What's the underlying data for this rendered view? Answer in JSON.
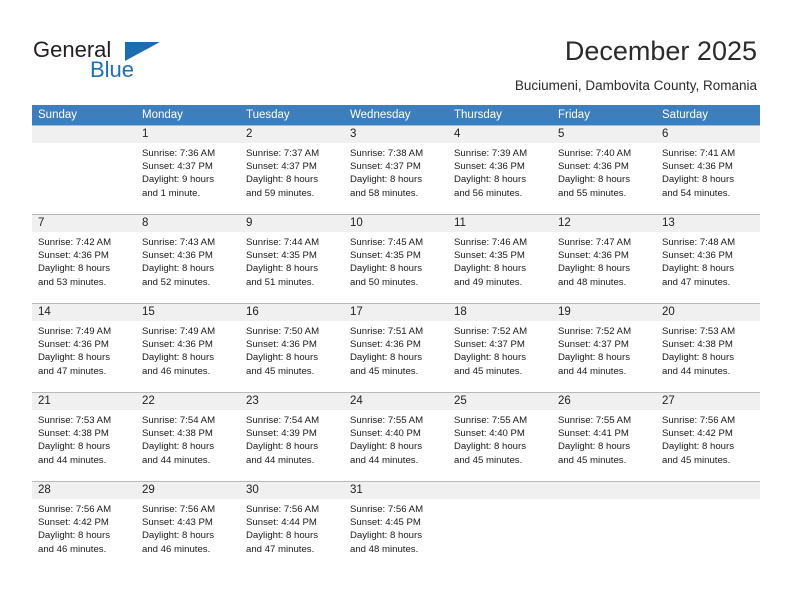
{
  "brand": {
    "name_part1": "General",
    "name_part2": "Blue",
    "triangle_color": "#1e6cb0",
    "blue_color": "#1f6fb5"
  },
  "header": {
    "title": "December 2025",
    "location": "Buciumeni, Dambovita County, Romania"
  },
  "theme": {
    "header_row_bg": "#3d7ebd",
    "header_row_text": "#ffffff",
    "daynum_band_bg": "#f0f0f0",
    "grid_line": "#b9b9b9",
    "body_text": "#1a1a1a"
  },
  "calendar": {
    "weekday_headers": [
      "Sunday",
      "Monday",
      "Tuesday",
      "Wednesday",
      "Thursday",
      "Friday",
      "Saturday"
    ],
    "weeks": [
      [
        {
          "day": "",
          "detail": ""
        },
        {
          "day": "1",
          "detail": "Sunrise: 7:36 AM\nSunset: 4:37 PM\nDaylight: 9 hours\nand 1 minute."
        },
        {
          "day": "2",
          "detail": "Sunrise: 7:37 AM\nSunset: 4:37 PM\nDaylight: 8 hours\nand 59 minutes."
        },
        {
          "day": "3",
          "detail": "Sunrise: 7:38 AM\nSunset: 4:37 PM\nDaylight: 8 hours\nand 58 minutes."
        },
        {
          "day": "4",
          "detail": "Sunrise: 7:39 AM\nSunset: 4:36 PM\nDaylight: 8 hours\nand 56 minutes."
        },
        {
          "day": "5",
          "detail": "Sunrise: 7:40 AM\nSunset: 4:36 PM\nDaylight: 8 hours\nand 55 minutes."
        },
        {
          "day": "6",
          "detail": "Sunrise: 7:41 AM\nSunset: 4:36 PM\nDaylight: 8 hours\nand 54 minutes."
        }
      ],
      [
        {
          "day": "7",
          "detail": "Sunrise: 7:42 AM\nSunset: 4:36 PM\nDaylight: 8 hours\nand 53 minutes."
        },
        {
          "day": "8",
          "detail": "Sunrise: 7:43 AM\nSunset: 4:36 PM\nDaylight: 8 hours\nand 52 minutes."
        },
        {
          "day": "9",
          "detail": "Sunrise: 7:44 AM\nSunset: 4:35 PM\nDaylight: 8 hours\nand 51 minutes."
        },
        {
          "day": "10",
          "detail": "Sunrise: 7:45 AM\nSunset: 4:35 PM\nDaylight: 8 hours\nand 50 minutes."
        },
        {
          "day": "11",
          "detail": "Sunrise: 7:46 AM\nSunset: 4:35 PM\nDaylight: 8 hours\nand 49 minutes."
        },
        {
          "day": "12",
          "detail": "Sunrise: 7:47 AM\nSunset: 4:36 PM\nDaylight: 8 hours\nand 48 minutes."
        },
        {
          "day": "13",
          "detail": "Sunrise: 7:48 AM\nSunset: 4:36 PM\nDaylight: 8 hours\nand 47 minutes."
        }
      ],
      [
        {
          "day": "14",
          "detail": "Sunrise: 7:49 AM\nSunset: 4:36 PM\nDaylight: 8 hours\nand 47 minutes."
        },
        {
          "day": "15",
          "detail": "Sunrise: 7:49 AM\nSunset: 4:36 PM\nDaylight: 8 hours\nand 46 minutes."
        },
        {
          "day": "16",
          "detail": "Sunrise: 7:50 AM\nSunset: 4:36 PM\nDaylight: 8 hours\nand 45 minutes."
        },
        {
          "day": "17",
          "detail": "Sunrise: 7:51 AM\nSunset: 4:36 PM\nDaylight: 8 hours\nand 45 minutes."
        },
        {
          "day": "18",
          "detail": "Sunrise: 7:52 AM\nSunset: 4:37 PM\nDaylight: 8 hours\nand 45 minutes."
        },
        {
          "day": "19",
          "detail": "Sunrise: 7:52 AM\nSunset: 4:37 PM\nDaylight: 8 hours\nand 44 minutes."
        },
        {
          "day": "20",
          "detail": "Sunrise: 7:53 AM\nSunset: 4:38 PM\nDaylight: 8 hours\nand 44 minutes."
        }
      ],
      [
        {
          "day": "21",
          "detail": "Sunrise: 7:53 AM\nSunset: 4:38 PM\nDaylight: 8 hours\nand 44 minutes."
        },
        {
          "day": "22",
          "detail": "Sunrise: 7:54 AM\nSunset: 4:38 PM\nDaylight: 8 hours\nand 44 minutes."
        },
        {
          "day": "23",
          "detail": "Sunrise: 7:54 AM\nSunset: 4:39 PM\nDaylight: 8 hours\nand 44 minutes."
        },
        {
          "day": "24",
          "detail": "Sunrise: 7:55 AM\nSunset: 4:40 PM\nDaylight: 8 hours\nand 44 minutes."
        },
        {
          "day": "25",
          "detail": "Sunrise: 7:55 AM\nSunset: 4:40 PM\nDaylight: 8 hours\nand 45 minutes."
        },
        {
          "day": "26",
          "detail": "Sunrise: 7:55 AM\nSunset: 4:41 PM\nDaylight: 8 hours\nand 45 minutes."
        },
        {
          "day": "27",
          "detail": "Sunrise: 7:56 AM\nSunset: 4:42 PM\nDaylight: 8 hours\nand 45 minutes."
        }
      ],
      [
        {
          "day": "28",
          "detail": "Sunrise: 7:56 AM\nSunset: 4:42 PM\nDaylight: 8 hours\nand 46 minutes."
        },
        {
          "day": "29",
          "detail": "Sunrise: 7:56 AM\nSunset: 4:43 PM\nDaylight: 8 hours\nand 46 minutes."
        },
        {
          "day": "30",
          "detail": "Sunrise: 7:56 AM\nSunset: 4:44 PM\nDaylight: 8 hours\nand 47 minutes."
        },
        {
          "day": "31",
          "detail": "Sunrise: 7:56 AM\nSunset: 4:45 PM\nDaylight: 8 hours\nand 48 minutes."
        },
        {
          "day": "",
          "detail": ""
        },
        {
          "day": "",
          "detail": ""
        },
        {
          "day": "",
          "detail": ""
        }
      ]
    ]
  }
}
